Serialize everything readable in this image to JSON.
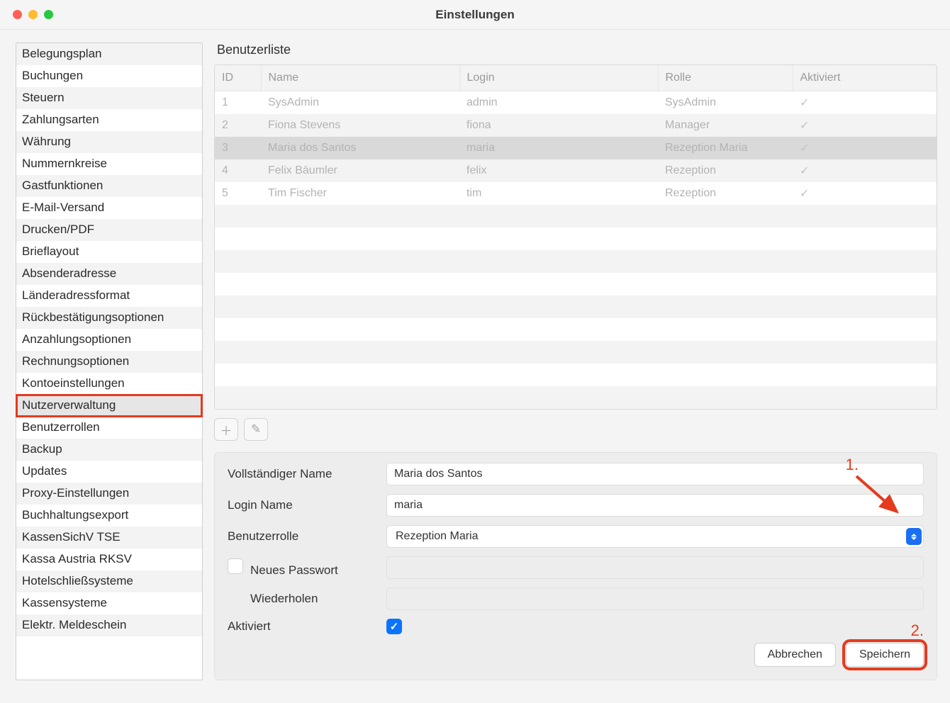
{
  "window": {
    "title": "Einstellungen"
  },
  "sidebar": {
    "items": [
      "Belegungsplan",
      "Buchungen",
      "Steuern",
      "Zahlungsarten",
      "Währung",
      "Nummernkreise",
      "Gastfunktionen",
      "E-Mail-Versand",
      "Drucken/PDF",
      "Brieflayout",
      "Absenderadresse",
      "Länderadressformat",
      "Rückbestätigungsoptionen",
      "Anzahlungsoptionen",
      "Rechnungsoptionen",
      "Kontoeinstellungen",
      "Nutzerverwaltung",
      "Benutzerrollen",
      "Backup",
      "Updates",
      "Proxy-Einstellungen",
      "Buchhaltungsexport",
      "KassenSichV TSE",
      "Kassa Austria RKSV",
      "Hotelschließsysteme",
      "Kassensysteme",
      "Elektr. Meldeschein"
    ],
    "active_index": 16
  },
  "userlist": {
    "title": "Benutzerliste",
    "columns": {
      "id": "ID",
      "name": "Name",
      "login": "Login",
      "role": "Rolle",
      "active": "Aktiviert"
    },
    "rows": [
      {
        "id": "1",
        "name": "SysAdmin",
        "login": "admin",
        "role": "SysAdmin",
        "active": "✓"
      },
      {
        "id": "2",
        "name": "Fiona Stevens",
        "login": "fiona",
        "role": "Manager",
        "active": "✓"
      },
      {
        "id": "3",
        "name": "Maria dos Santos",
        "login": "maria",
        "role": "Rezeption Maria",
        "active": "✓"
      },
      {
        "id": "4",
        "name": "Felix Bäumler",
        "login": "felix",
        "role": "Rezeption",
        "active": "✓"
      },
      {
        "id": "5",
        "name": "Tim Fischer",
        "login": "tim",
        "role": "Rezeption",
        "active": "✓"
      }
    ],
    "selected_index": 2,
    "empty_rows": 9
  },
  "toolbar": {
    "add_icon": "＋",
    "edit_icon": "✎"
  },
  "form": {
    "labels": {
      "fullname": "Vollständiger Name",
      "login": "Login Name",
      "role": "Benutzerrolle",
      "newpass": "Neues Passwort",
      "repeat": "Wiederholen",
      "active": "Aktiviert"
    },
    "values": {
      "fullname": "Maria dos Santos",
      "login": "maria",
      "role": "Rezeption Maria",
      "newpass": "",
      "repeat": "",
      "active_checked": true,
      "newpass_checked": false
    },
    "buttons": {
      "cancel": "Abbrechen",
      "save": "Speichern"
    }
  },
  "annotations": {
    "a1": "1.",
    "a2": "2."
  }
}
